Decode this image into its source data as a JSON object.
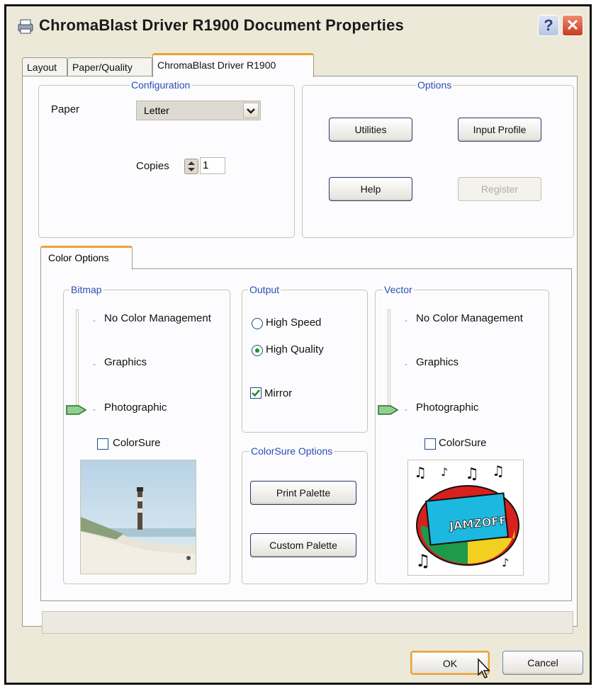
{
  "window": {
    "title": "ChromaBlast Driver R1900 Document Properties",
    "help_button": "?",
    "close_button": "✕"
  },
  "tabs": [
    {
      "label": "Layout",
      "active": false
    },
    {
      "label": "Paper/Quality",
      "active": false
    },
    {
      "label": "ChromaBlast Driver R1900",
      "active": true
    }
  ],
  "configuration": {
    "legend": "Configuration",
    "paper_label": "Paper",
    "paper_value": "Letter",
    "copies_label": "Copies",
    "copies_value": "1"
  },
  "options": {
    "legend": "Options",
    "utilities": "Utilities",
    "input_profile": "Input Profile",
    "help": "Help",
    "register": "Register",
    "register_enabled": false
  },
  "color_options": {
    "tab_label": "Color Options",
    "bitmap": {
      "legend": "Bitmap",
      "levels": [
        "No Color Management",
        "Graphics",
        "Photographic"
      ],
      "selected": "Photographic",
      "colorsure_label": "ColorSure",
      "colorsure_checked": false
    },
    "output": {
      "legend": "Output",
      "high_speed": "High Speed",
      "high_quality": "High Quality",
      "selected": "High Quality",
      "mirror_label": "Mirror",
      "mirror_checked": true
    },
    "colorsure_options": {
      "legend": "ColorSure Options",
      "print_palette": "Print Palette",
      "custom_palette": "Custom Palette"
    },
    "vector": {
      "legend": "Vector",
      "levels": [
        "No Color Management",
        "Graphics",
        "Photographic"
      ],
      "selected": "Photographic",
      "colorsure_label": "ColorSure",
      "colorsure_checked": false
    },
    "vector_preview_text": "JAMZOFF"
  },
  "footer": {
    "ok": "OK",
    "cancel": "Cancel"
  },
  "colors": {
    "accent_tab": "#f0a030",
    "legend_blue": "#2a4fb0",
    "dialog_bg": "#ece9d8",
    "close_red": "#c63d1d"
  }
}
